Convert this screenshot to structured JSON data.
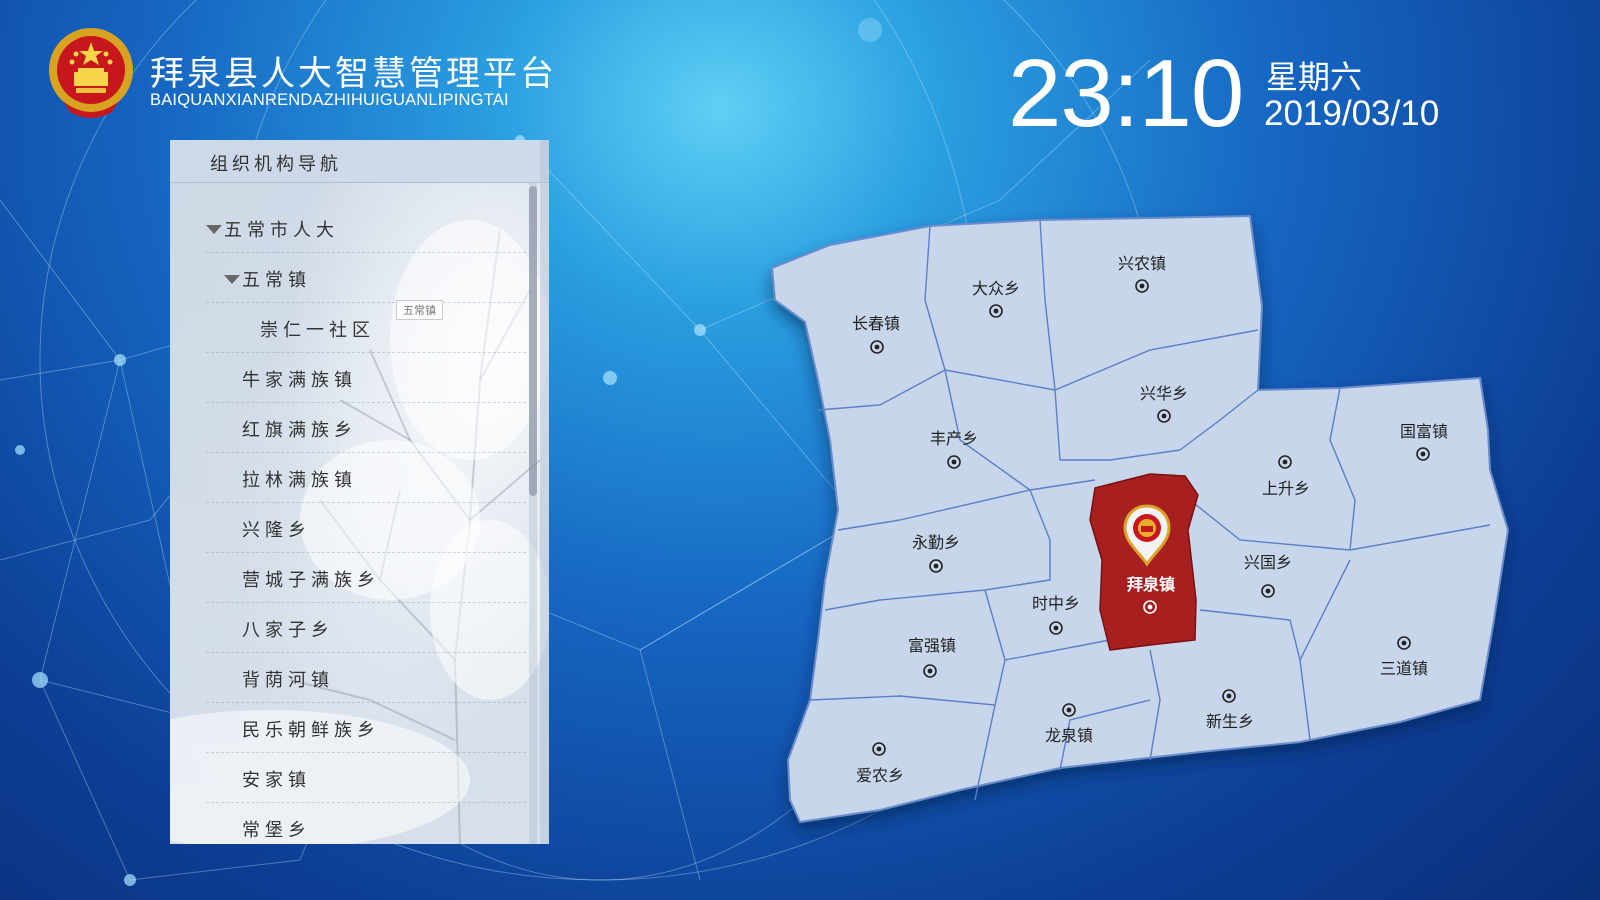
{
  "header": {
    "title_cn": "拜泉县人大智慧管理平台",
    "title_en": "BAIQUANXIANRENDAZHIHUIGUANLIPINGTAI",
    "emblem_icon": "national-emblem-icon"
  },
  "clock": {
    "time": "23:10",
    "weekday": "星期六",
    "date": "2019/03/10"
  },
  "nav": {
    "title": "组织机构导航",
    "tooltip": "五常镇",
    "items": [
      {
        "label": "五常市人大",
        "expanded": true
      },
      {
        "label": "五常镇",
        "expanded": true
      },
      {
        "label": "崇仁一社区"
      },
      {
        "label": "牛家满族镇"
      },
      {
        "label": "红旗满族乡"
      },
      {
        "label": "拉林满族镇"
      },
      {
        "label": "兴隆乡"
      },
      {
        "label": "营城子满族乡"
      },
      {
        "label": "八家子乡"
      },
      {
        "label": "背荫河镇"
      },
      {
        "label": "民乐朝鲜族乡"
      },
      {
        "label": "安家镇"
      },
      {
        "label": "常堡乡"
      }
    ]
  },
  "map": {
    "region_color": "#c7d6ea",
    "border_color": "#5b7fc6",
    "selected_color": "#a81f1f",
    "marker_icon": "target-icon",
    "selected_pin_icon": "emblem-pin-icon",
    "selected": "拜泉镇",
    "towns": [
      {
        "id": "changchun",
        "name": "长春镇"
      },
      {
        "id": "dazhong",
        "name": "大众乡"
      },
      {
        "id": "xingnong",
        "name": "兴农镇"
      },
      {
        "id": "xinghua",
        "name": "兴华乡"
      },
      {
        "id": "fengchan",
        "name": "丰产乡"
      },
      {
        "id": "guofu",
        "name": "国富镇"
      },
      {
        "id": "shangsheng",
        "name": "上升乡"
      },
      {
        "id": "yongqin",
        "name": "永勤乡"
      },
      {
        "id": "baiquan",
        "name": "拜泉镇"
      },
      {
        "id": "xingguo",
        "name": "兴国乡"
      },
      {
        "id": "shizhong",
        "name": "时中乡"
      },
      {
        "id": "fuqiang",
        "name": "富强镇"
      },
      {
        "id": "sandao",
        "name": "三道镇"
      },
      {
        "id": "longquan",
        "name": "龙泉镇"
      },
      {
        "id": "xinsheng",
        "name": "新生乡"
      },
      {
        "id": "ainong",
        "name": "爱农乡"
      }
    ]
  }
}
